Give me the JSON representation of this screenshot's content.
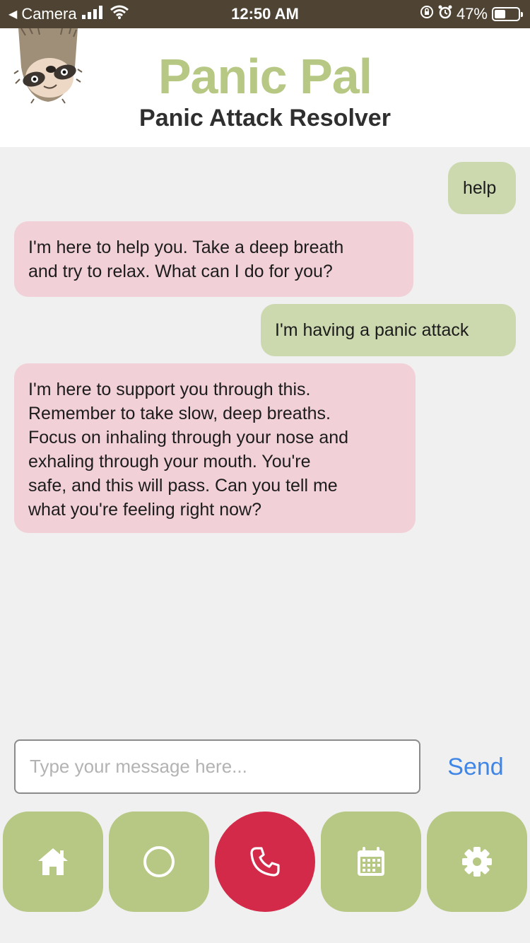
{
  "status_bar": {
    "back_app": "Camera",
    "time": "12:50 AM",
    "battery_percent": "47%",
    "battery_level": 0.47
  },
  "header": {
    "title": "Panic Pal",
    "subtitle": "Panic Attack Resolver",
    "mascot": "sloth-mascot"
  },
  "chat": {
    "messages": [
      {
        "sender": "user",
        "text": "help"
      },
      {
        "sender": "bot",
        "text": "I'm here to help you. Take a deep breath\nand try to relax. What can I do for you?"
      },
      {
        "sender": "user",
        "text": "I'm having a panic attack"
      },
      {
        "sender": "bot",
        "text": "I'm here to support you through this.\nRemember to take slow, deep breaths.\nFocus on inhaling through your nose and\nexhaling through your mouth. You're\nsafe, and this will pass. Can you tell me\nwhat you're feeling right now?"
      }
    ]
  },
  "composer": {
    "placeholder": "Type your message here...",
    "value": "",
    "send_label": "Send"
  },
  "nav": {
    "items": [
      {
        "icon": "home-icon"
      },
      {
        "icon": "circle-icon"
      },
      {
        "icon": "phone-icon"
      },
      {
        "icon": "calendar-icon"
      },
      {
        "icon": "gear-icon"
      }
    ]
  },
  "colors": {
    "accent_green": "#b6c884",
    "user_bubble": "#ccd9ae",
    "bot_bubble": "#f2d0d8",
    "call_red": "#d32a4a",
    "link_blue": "#3f86e6",
    "status_bar": "#4f4433"
  }
}
